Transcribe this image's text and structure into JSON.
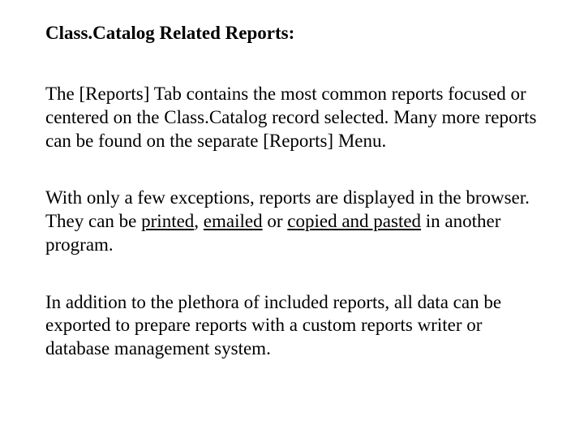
{
  "title": "Class.Catalog Related Reports:",
  "p1": "The [Reports] Tab contains the most common reports focused or centered on the Class.Catalog record selected.  Many more reports can be found on the separate [Reports] Menu.",
  "p2_a": "With only a few exceptions, reports are displayed in the browser.  They can be ",
  "p2_u1": "printed",
  "p2_b": ", ",
  "p2_u2": "emailed",
  "p2_c": " or ",
  "p2_u3": "copied and pasted",
  "p2_d": " in another program.",
  "p3": "In addition to the plethora of included reports, all data can be exported to prepare reports with a custom reports writer or database management system."
}
